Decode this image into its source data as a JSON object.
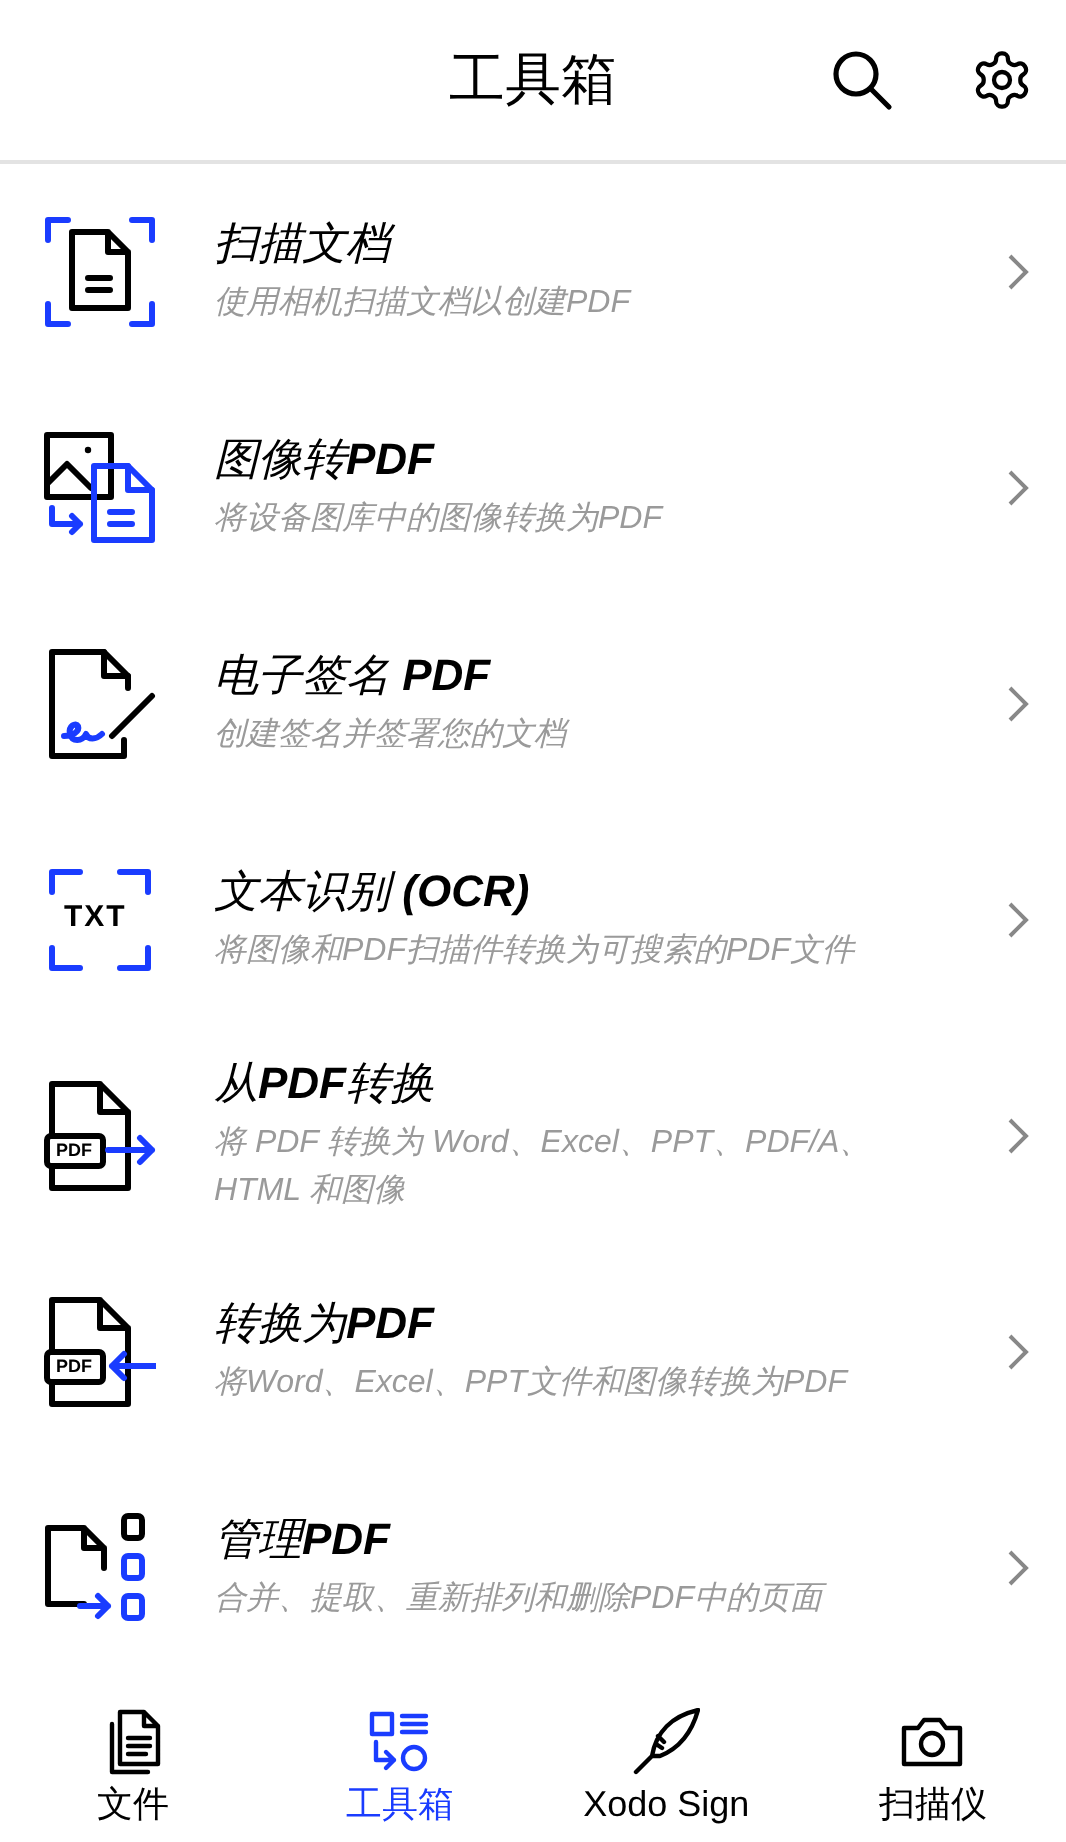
{
  "header": {
    "title": "工具箱"
  },
  "tools": [
    {
      "kind": "scan",
      "title": "扫描文档",
      "description": "使用相机扫描文档以创建PDF"
    },
    {
      "kind": "image",
      "title": "图像转**PDF**",
      "description": "将设备图库中的图像转换为PDF"
    },
    {
      "kind": "sign",
      "title": "电子签名 **PDF**",
      "description": "创建签名并签署您的文档"
    },
    {
      "kind": "ocr",
      "icon_text": "TXT",
      "title": "文本识别 **(OCR)**",
      "description": "将图像和PDF扫描件转换为可搜索的PDF文件"
    },
    {
      "kind": "from",
      "icon_text": "PDF",
      "title": "从**PDF**转换",
      "description": "将 PDF 转换为 Word、Excel、PPT、PDF/A、HTML 和图像"
    },
    {
      "kind": "to",
      "icon_text": "PDF",
      "title": "转换为**PDF**",
      "description": "将Word、Excel、PPT文件和图像转换为PDF"
    },
    {
      "kind": "manage",
      "title": "管理**PDF**",
      "description": "合并、提取、重新排列和删除PDF中的页面"
    }
  ],
  "bottom_nav": [
    {
      "kind": "files",
      "label": "文件",
      "selected": false
    },
    {
      "kind": "tools",
      "label": "工具箱",
      "selected": true
    },
    {
      "kind": "sign",
      "label": "Xodo Sign",
      "selected": false
    },
    {
      "kind": "scanner",
      "label": "扫描仪",
      "selected": false
    }
  ]
}
